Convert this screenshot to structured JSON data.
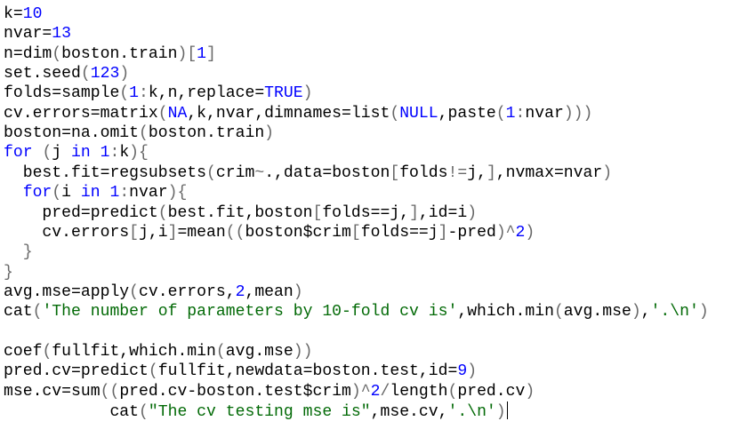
{
  "editor": {
    "lines": [
      [
        [
          "k=",
          "default"
        ],
        [
          "10",
          "number"
        ]
      ],
      [
        [
          "nvar=",
          "default"
        ],
        [
          "13",
          "number"
        ]
      ],
      [
        [
          "n=dim",
          "default"
        ],
        [
          "(",
          "paren"
        ],
        [
          "boston.train",
          "default"
        ],
        [
          ")",
          "paren"
        ],
        [
          "[",
          "paren"
        ],
        [
          "1",
          "number"
        ],
        [
          "]",
          "paren"
        ]
      ],
      [
        [
          "set.seed",
          "default"
        ],
        [
          "(",
          "paren"
        ],
        [
          "123",
          "number"
        ],
        [
          ")",
          "paren"
        ]
      ],
      [
        [
          "folds=sample",
          "default"
        ],
        [
          "(",
          "paren"
        ],
        [
          "1",
          "number"
        ],
        [
          ":",
          "operator"
        ],
        [
          "k,n,replace=",
          "default"
        ],
        [
          "TRUE",
          "keyword"
        ],
        [
          ")",
          "paren"
        ]
      ],
      [
        [
          "cv.errors=matrix",
          "default"
        ],
        [
          "(",
          "paren"
        ],
        [
          "NA",
          "keyword"
        ],
        [
          ",k,nvar,dimnames=list",
          "default"
        ],
        [
          "(",
          "paren"
        ],
        [
          "NULL",
          "keyword"
        ],
        [
          ",paste",
          "default"
        ],
        [
          "(",
          "paren"
        ],
        [
          "1",
          "number"
        ],
        [
          ":",
          "operator"
        ],
        [
          "nvar",
          "default"
        ],
        [
          ")))",
          "paren"
        ]
      ],
      [
        [
          "boston=na.omit",
          "default"
        ],
        [
          "(",
          "paren"
        ],
        [
          "boston.train",
          "default"
        ],
        [
          ")",
          "paren"
        ]
      ],
      [
        [
          "for",
          "keyword"
        ],
        [
          " ",
          "default"
        ],
        [
          "(",
          "paren"
        ],
        [
          "j ",
          "default"
        ],
        [
          "in",
          "keyword"
        ],
        [
          " ",
          "default"
        ],
        [
          "1",
          "number"
        ],
        [
          ":",
          "operator"
        ],
        [
          "k",
          "default"
        ],
        [
          ")",
          "paren"
        ],
        [
          "{",
          "paren"
        ]
      ],
      [
        [
          "  best.fit=regsubsets",
          "default"
        ],
        [
          "(",
          "paren"
        ],
        [
          "crim",
          "default"
        ],
        [
          "~",
          "operator"
        ],
        [
          ".,data=boston",
          "default"
        ],
        [
          "[",
          "paren"
        ],
        [
          "folds",
          "default"
        ],
        [
          "!=",
          "operator"
        ],
        [
          "j,",
          "default"
        ],
        [
          "]",
          "paren"
        ],
        [
          ",nvmax=nvar",
          "default"
        ],
        [
          ")",
          "paren"
        ]
      ],
      [
        [
          "  ",
          "default"
        ],
        [
          "for",
          "keyword"
        ],
        [
          "(",
          "paren"
        ],
        [
          "i ",
          "default"
        ],
        [
          "in",
          "keyword"
        ],
        [
          " ",
          "default"
        ],
        [
          "1",
          "number"
        ],
        [
          ":",
          "operator"
        ],
        [
          "nvar",
          "default"
        ],
        [
          ")",
          "paren"
        ],
        [
          "{",
          "paren"
        ]
      ],
      [
        [
          "    pred=predict",
          "default"
        ],
        [
          "(",
          "paren"
        ],
        [
          "best.fit,boston",
          "default"
        ],
        [
          "[",
          "paren"
        ],
        [
          "folds==j,",
          "default"
        ],
        [
          "]",
          "paren"
        ],
        [
          ",id=i",
          "default"
        ],
        [
          ")",
          "paren"
        ]
      ],
      [
        [
          "    cv.errors",
          "default"
        ],
        [
          "[",
          "paren"
        ],
        [
          "j,i",
          "default"
        ],
        [
          "]",
          "paren"
        ],
        [
          "=mean",
          "default"
        ],
        [
          "((",
          "paren"
        ],
        [
          "boston$crim",
          "default"
        ],
        [
          "[",
          "paren"
        ],
        [
          "folds==j",
          "default"
        ],
        [
          "]",
          "paren"
        ],
        [
          "-pred",
          "default"
        ],
        [
          ")",
          "paren"
        ],
        [
          "^",
          "operator"
        ],
        [
          "2",
          "number"
        ],
        [
          ")",
          "paren"
        ]
      ],
      [
        [
          "  ",
          "default"
        ],
        [
          "}",
          "paren"
        ]
      ],
      [
        [
          "}",
          "paren"
        ]
      ],
      [
        [
          "avg.mse=apply",
          "default"
        ],
        [
          "(",
          "paren"
        ],
        [
          "cv.errors,",
          "default"
        ],
        [
          "2",
          "number"
        ],
        [
          ",mean",
          "default"
        ],
        [
          ")",
          "paren"
        ]
      ],
      [
        [
          "cat",
          "default"
        ],
        [
          "(",
          "paren"
        ],
        [
          "'The number of parameters by 10-fold cv is'",
          "string"
        ],
        [
          ",which.min",
          "default"
        ],
        [
          "(",
          "paren"
        ],
        [
          "avg.mse",
          "default"
        ],
        [
          ")",
          "paren"
        ],
        [
          ",",
          "default"
        ],
        [
          "'.\\n'",
          "string"
        ],
        [
          ")",
          "paren"
        ]
      ],
      [],
      [
        [
          "coef",
          "default"
        ],
        [
          "(",
          "paren"
        ],
        [
          "fullfit,which.min",
          "default"
        ],
        [
          "(",
          "paren"
        ],
        [
          "avg.mse",
          "default"
        ],
        [
          "))",
          "paren"
        ]
      ],
      [
        [
          "pred.cv=predict",
          "default"
        ],
        [
          "(",
          "paren"
        ],
        [
          "fullfit,newdata=boston.test,id=",
          "default"
        ],
        [
          "9",
          "number"
        ],
        [
          ")",
          "paren"
        ]
      ],
      [
        [
          "mse.cv=sum",
          "default"
        ],
        [
          "((",
          "paren"
        ],
        [
          "pred.cv-boston.test$crim",
          "default"
        ],
        [
          ")",
          "paren"
        ],
        [
          "^",
          "operator"
        ],
        [
          "2",
          "number"
        ],
        [
          "/",
          "operator"
        ],
        [
          "length",
          "default"
        ],
        [
          "(",
          "paren"
        ],
        [
          "pred.cv",
          "default"
        ],
        [
          ")",
          "paren"
        ]
      ],
      [
        [
          "           cat",
          "default"
        ],
        [
          "(",
          "paren"
        ],
        [
          "\"The cv testing mse is\"",
          "string"
        ],
        [
          ",mse.cv,",
          "default"
        ],
        [
          "'.\\n'",
          "string"
        ],
        [
          ")",
          "paren"
        ]
      ]
    ],
    "cursor_line": 21
  },
  "colors": {
    "default": "#000000",
    "number": "#0000ff",
    "keyword": "#0000ff",
    "string": "#036a07",
    "paren": "#686868",
    "operator": "#686868",
    "background": "#ffffff"
  }
}
